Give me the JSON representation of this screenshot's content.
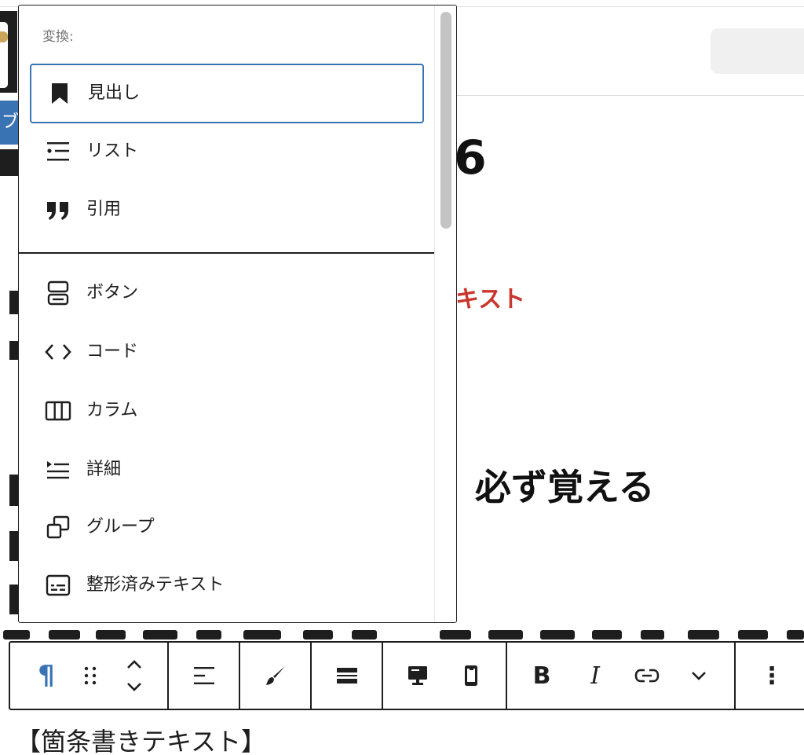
{
  "background": {
    "sidebar_tab_char": "ブ",
    "heading_fragment": "6",
    "red_text_fragment": "キスト",
    "bold_heading_fragment": "必ず覚える",
    "list_text": "【箇条書きテキスト】"
  },
  "transform_menu": {
    "label": "変換:",
    "items": [
      {
        "label": "見出し",
        "icon": "bookmark-icon",
        "selected": true
      },
      {
        "label": "リスト",
        "icon": "list-icon",
        "selected": false
      },
      {
        "label": "引用",
        "icon": "quote-icon",
        "selected": false
      },
      {
        "label": "ボタン",
        "icon": "button-icon",
        "selected": false
      },
      {
        "label": "コード",
        "icon": "code-icon",
        "selected": false
      },
      {
        "label": "カラム",
        "icon": "columns-icon",
        "selected": false
      },
      {
        "label": "詳細",
        "icon": "details-icon",
        "selected": false
      },
      {
        "label": "グループ",
        "icon": "group-icon",
        "selected": false
      },
      {
        "label": "整形済みテキスト",
        "icon": "preformatted-icon",
        "selected": false
      }
    ]
  },
  "toolbar": {
    "paragraph": "¶",
    "bold": "B",
    "italic": "I",
    "more": "⋮",
    "icons": [
      "paragraph-icon",
      "drag-handle-icon",
      "move-up-down-icon",
      "align-icon",
      "brush-icon",
      "separator-icon",
      "desktop-icon",
      "mobile-icon",
      "bold-icon",
      "italic-icon",
      "link-icon",
      "chevron-down-icon",
      "more-options-icon"
    ]
  },
  "colors": {
    "accent_blue": "#3a73b3",
    "text_dark": "#1e1e1e",
    "red_text": "#c9362e",
    "label_gray": "#757575"
  }
}
